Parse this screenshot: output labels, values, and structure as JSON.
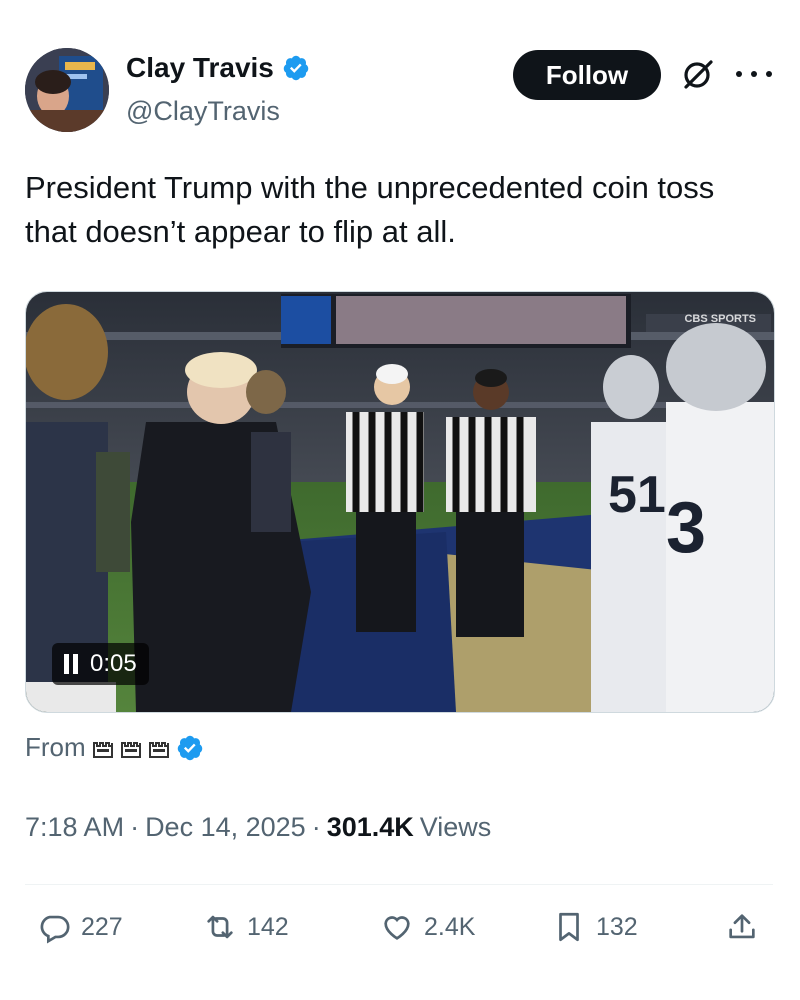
{
  "author": {
    "name": "Clay Travis",
    "handle": "@ClayTravis",
    "verified": true
  },
  "header": {
    "follow_label": "Follow",
    "icons": [
      "grok-icon",
      "more-icon"
    ]
  },
  "tweet": {
    "text": "President Trump with the unprecedented coin toss that doesn’t appear to flip at all."
  },
  "media": {
    "type": "video",
    "state": "playing",
    "time": "0:05",
    "broadcaster": "CBS SPORTS"
  },
  "source": {
    "from_label": "From",
    "badge_count": 3
  },
  "meta": {
    "time": "7:18 AM",
    "separator": "·",
    "date": "Dec 14, 2025",
    "views_count": "301.4K",
    "views_label": "Views"
  },
  "actions": {
    "replies": "227",
    "reposts": "142",
    "likes": "2.4K",
    "bookmarks": "132"
  },
  "colors": {
    "accent": "#1d9bf0",
    "text": "#0f1419",
    "muted": "#536471"
  }
}
